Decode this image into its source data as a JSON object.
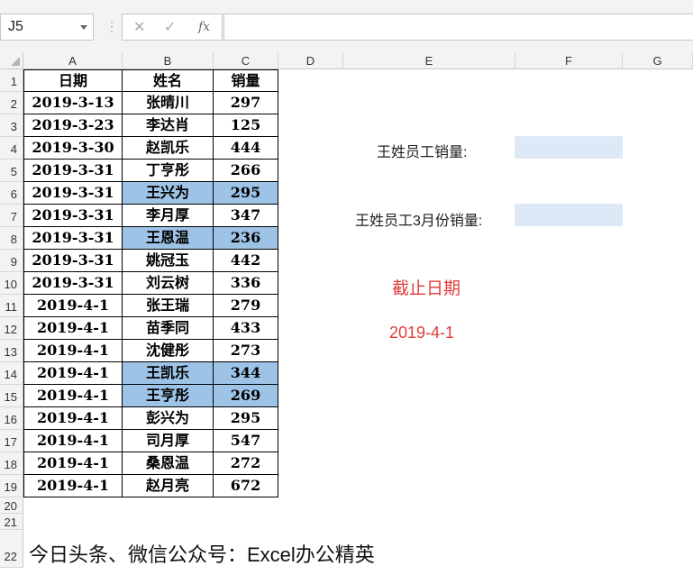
{
  "formula_bar": {
    "name_box": "J5",
    "separator": "⋮",
    "cancel": "✕",
    "enter": "✓",
    "fx": "fx",
    "formula": ""
  },
  "columns": [
    "A",
    "B",
    "C",
    "D",
    "E",
    "F",
    "G"
  ],
  "rows": [
    "1",
    "2",
    "3",
    "4",
    "5",
    "6",
    "7",
    "8",
    "9",
    "10",
    "11",
    "12",
    "13",
    "14",
    "15",
    "16",
    "17",
    "18",
    "19",
    "20",
    "21",
    "22"
  ],
  "table": {
    "headers": [
      "日期",
      "姓名",
      "销量"
    ],
    "rows": [
      {
        "date": "2019-3-13",
        "name": "张晴川",
        "sales": "297",
        "highlight": false
      },
      {
        "date": "2019-3-23",
        "name": "李达肖",
        "sales": "125",
        "highlight": false
      },
      {
        "date": "2019-3-30",
        "name": "赵凯乐",
        "sales": "444",
        "highlight": false
      },
      {
        "date": "2019-3-31",
        "name": "丁亨彤",
        "sales": "266",
        "highlight": false
      },
      {
        "date": "2019-3-31",
        "name": "王兴为",
        "sales": "295",
        "highlight": true
      },
      {
        "date": "2019-3-31",
        "name": "李月厚",
        "sales": "347",
        "highlight": false
      },
      {
        "date": "2019-3-31",
        "name": "王恩温",
        "sales": "236",
        "highlight": true
      },
      {
        "date": "2019-3-31",
        "name": "姚冠玉",
        "sales": "442",
        "highlight": false
      },
      {
        "date": "2019-3-31",
        "name": "刘云树",
        "sales": "336",
        "highlight": false
      },
      {
        "date": "2019-4-1",
        "name": "张王瑞",
        "sales": "279",
        "highlight": false
      },
      {
        "date": "2019-4-1",
        "name": "苗季同",
        "sales": "433",
        "highlight": false
      },
      {
        "date": "2019-4-1",
        "name": "沈健彤",
        "sales": "273",
        "highlight": false
      },
      {
        "date": "2019-4-1",
        "name": "王凯乐",
        "sales": "344",
        "highlight": true
      },
      {
        "date": "2019-4-1",
        "name": "王亨彤",
        "sales": "269",
        "highlight": true
      },
      {
        "date": "2019-4-1",
        "name": "彭兴为",
        "sales": "295",
        "highlight": false
      },
      {
        "date": "2019-4-1",
        "name": "司月厚",
        "sales": "547",
        "highlight": false
      },
      {
        "date": "2019-4-1",
        "name": "桑恩温",
        "sales": "272",
        "highlight": false
      },
      {
        "date": "2019-4-1",
        "name": "赵月亮",
        "sales": "672",
        "highlight": false
      }
    ]
  },
  "side": {
    "wang_sales_label": "王姓员工销量:",
    "wang_march_sales_label": "王姓员工3月份销量:",
    "cutoff_title": "截止日期",
    "cutoff_date": "2019-4-1"
  },
  "footer": "今日头条、微信公众号：Excel办公精英",
  "colors": {
    "highlight": "#9dc3e6",
    "input_fill": "#dde9f6",
    "red_text": "#e23b3b"
  }
}
